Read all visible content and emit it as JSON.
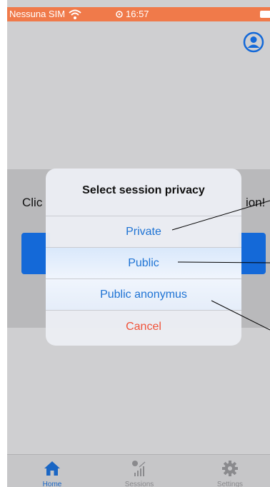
{
  "status_bar": {
    "carrier": "Nessuna SIM",
    "time": "16:57",
    "background_color": "#f07a4a"
  },
  "header": {
    "profile_icon": "account-circle-icon",
    "profile_icon_color": "#1469d8"
  },
  "background": {
    "text_left": "Clic",
    "text_right": "ion!",
    "button_color": "#1469d8"
  },
  "dialog": {
    "title": "Select session privacy",
    "options": [
      {
        "label": "Private"
      },
      {
        "label": "Public"
      },
      {
        "label": "Public anonymus"
      }
    ],
    "cancel_label": "Cancel",
    "option_color": "#1e73d4",
    "cancel_color": "#f0533a"
  },
  "tab_bar": {
    "tabs": [
      {
        "label": "Home",
        "icon": "home-icon",
        "active": true
      },
      {
        "label": "Sessions",
        "icon": "chart-icon",
        "active": false
      },
      {
        "label": "Settings",
        "icon": "gear-icon",
        "active": false
      }
    ],
    "active_color": "#1a66c4",
    "inactive_color": "#8a8a8d"
  }
}
